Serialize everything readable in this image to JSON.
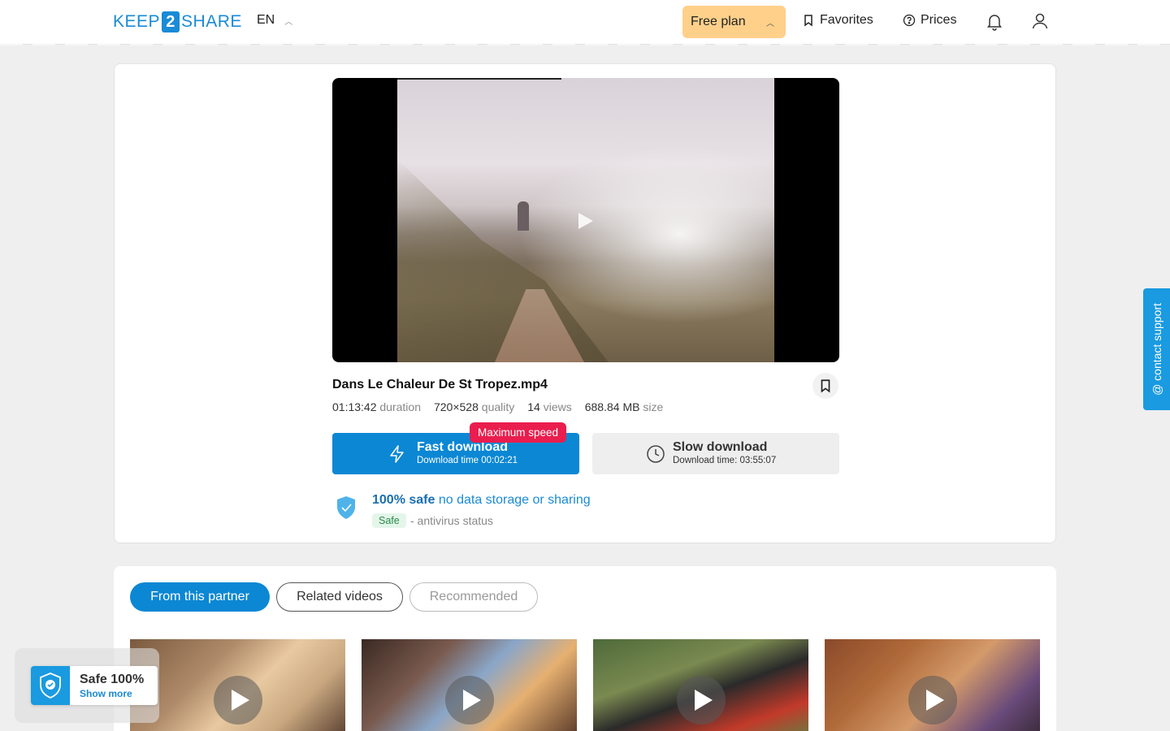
{
  "header": {
    "logo_left": "KEEP",
    "logo_mid": "2",
    "logo_right": "SHARE",
    "language": "EN",
    "plan_label": "Free plan",
    "favorites_label": "Favorites",
    "prices_label": "Prices"
  },
  "file": {
    "title": "Dans Le Chaleur De St Tropez.mp4",
    "duration_value": "01:13:42",
    "duration_label": "duration",
    "quality_value": "720×528",
    "quality_label": "quality",
    "views_value": "14",
    "views_label": "views",
    "size_value": "688.84 MB",
    "size_label": "size"
  },
  "download": {
    "fast_label": "Fast download",
    "fast_time": "Download time 00:02:21",
    "max_speed_badge": "Maximum speed",
    "slow_label": "Slow download",
    "slow_time": "Download time: 03:55:07"
  },
  "safety": {
    "headline_bold": "100% safe",
    "headline_rest": "no data storage or sharing",
    "chip": "Safe",
    "status": "- antivirus status"
  },
  "tabs": [
    {
      "label": "From this partner",
      "state": "active"
    },
    {
      "label": "Related videos",
      "state": "outlined"
    },
    {
      "label": "Recommended",
      "state": "dimmed"
    }
  ],
  "thumbnails": [
    {
      "icon": "play-icon"
    },
    {
      "icon": "play-icon"
    },
    {
      "icon": "play-icon"
    },
    {
      "icon": "play-icon"
    }
  ],
  "widgets": {
    "contact_support": "contact support",
    "safe_title": "Safe 100%",
    "safe_link": "Show more"
  },
  "colors": {
    "brand_blue": "#0b87d4",
    "plan_yellow": "#ffd08a",
    "badge_red": "#e91e4e",
    "safe_green": "#2a8a4a"
  }
}
